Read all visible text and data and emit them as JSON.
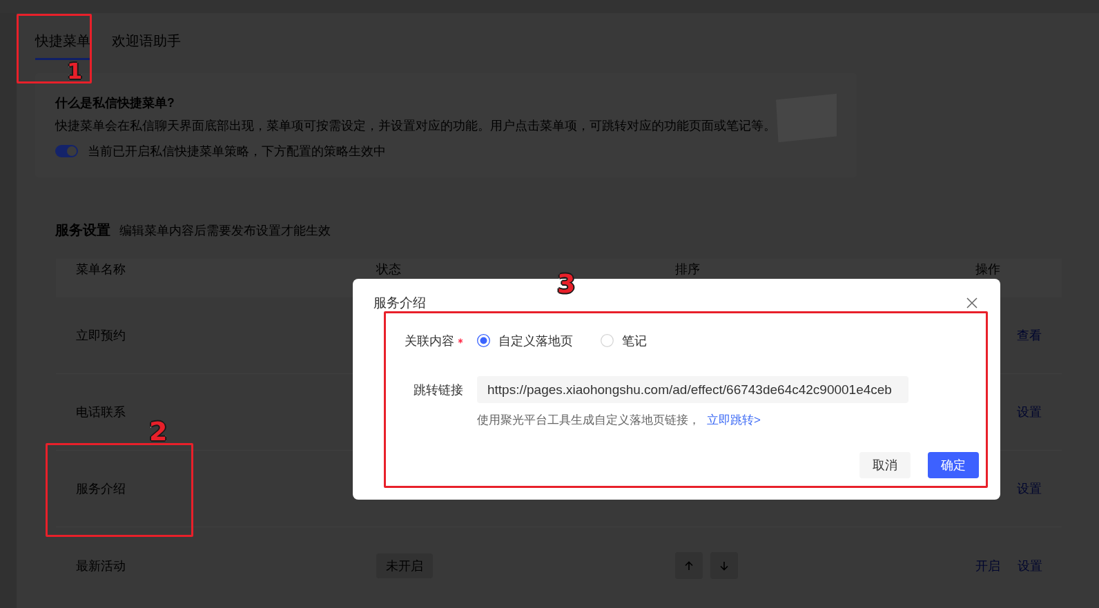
{
  "tabs": [
    {
      "label": "快捷菜单",
      "selected": true
    },
    {
      "label": "欢迎语助手",
      "selected": false
    }
  ],
  "intro": {
    "title": "什么是私信快捷菜单?",
    "description": "快捷菜单会在私信聊天界面底部出现，菜单项可按需设定，并设置对应的功能。用户点击菜单项，可跳转对应的功能页面或笔记等。",
    "toggle": {
      "on": true,
      "label": "当前已开启私信快捷菜单策略，下方配置的策略生效中"
    }
  },
  "service_settings": {
    "title": "服务设置",
    "hint": "编辑菜单内容后需要发布设置才能生效",
    "table": {
      "columns": [
        "菜单名称",
        "状态",
        "排序",
        "操作"
      ],
      "rows": [
        {
          "name": "立即预约",
          "actions": [
            "查看"
          ]
        },
        {
          "name": "电话联系",
          "actions": [
            "设置"
          ]
        },
        {
          "name": "服务介绍",
          "actions": [
            "设置"
          ]
        },
        {
          "name": "最新活动",
          "status": "未开启",
          "sort_controls": true,
          "actions": [
            "开启",
            "设置"
          ]
        }
      ]
    }
  },
  "dialog": {
    "title": "服务介绍",
    "fields": [
      {
        "kind": "radio",
        "label": "关联内容",
        "required": true,
        "options": [
          {
            "label": "自定义落地页",
            "selected": true
          },
          {
            "label": "笔记",
            "selected": false
          }
        ]
      },
      {
        "kind": "input",
        "label": "跳转链接",
        "value": "https://pages.xiaohongshu.com/ad/effect/66743de64c42c90001e4ceb",
        "hint": "使用聚光平台工具生成自定义落地页链接，",
        "link": "立即跳转>"
      }
    ],
    "buttons": [
      {
        "label": "取消",
        "kind": "secondary"
      },
      {
        "label": "确定",
        "kind": "primary"
      }
    ]
  },
  "annotations": [
    {
      "label": "1"
    },
    {
      "label": "2"
    },
    {
      "label": "3"
    }
  ]
}
